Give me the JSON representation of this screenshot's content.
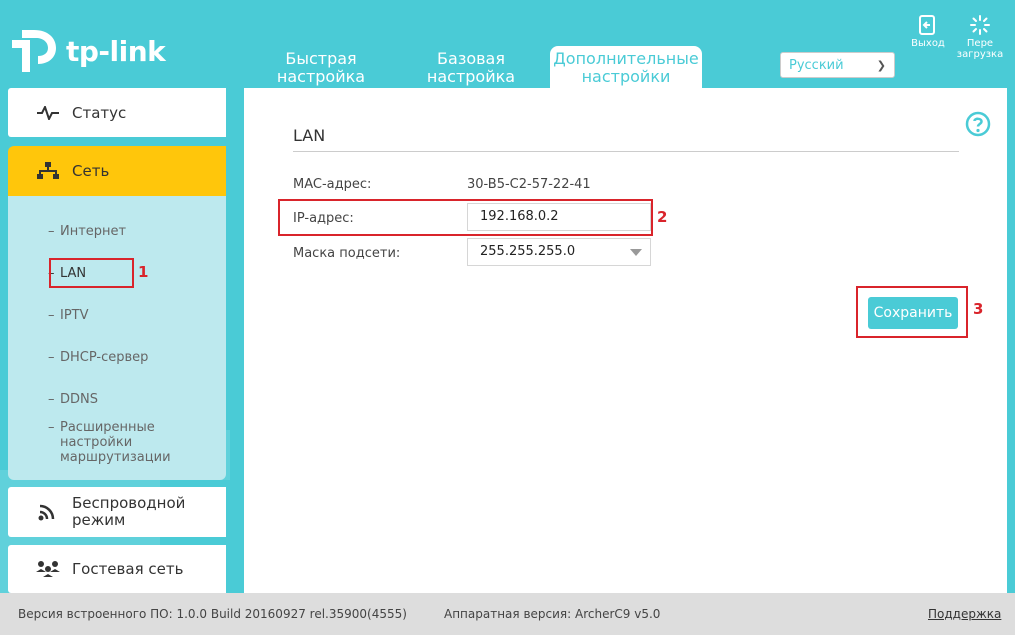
{
  "brand": {
    "logo_text": "tp-link"
  },
  "tabs": [
    {
      "label": "Быстрая\nнастройка"
    },
    {
      "label": "Базовая\nнастройка"
    },
    {
      "label": "Дополнительные\nнастройки"
    }
  ],
  "language": {
    "selected": "Русский"
  },
  "header_buttons": {
    "logout": "Выход",
    "reboot_line1": "Пере",
    "reboot_line2": "загрузка"
  },
  "sidebar": {
    "items": [
      {
        "label": "Статус",
        "icon": "pulse-icon"
      },
      {
        "label": "Сеть",
        "icon": "network-icon"
      },
      {
        "label": "Беспроводной режим",
        "icon": "wifi-icon"
      },
      {
        "label": "Гостевая сеть",
        "icon": "guest-icon"
      }
    ],
    "submenu": [
      {
        "label": "Интернет"
      },
      {
        "label": "LAN"
      },
      {
        "label": "IPTV"
      },
      {
        "label": "DHCP-сервер"
      },
      {
        "label": "DDNS"
      },
      {
        "label": "Расширенные настройки маршрутизации"
      }
    ],
    "wireless_line1": "Беспроводной",
    "wireless_line2": "режим"
  },
  "lan": {
    "title": "LAN",
    "mac_label": "MAC-адрес:",
    "mac_value": "30-B5-C2-57-22-41",
    "ip_label": "IP-адрес:",
    "ip_value": "192.168.0.2",
    "mask_label": "Маска подсети:",
    "mask_value": "255.255.255.0",
    "save_label": "Сохранить"
  },
  "annotations": {
    "n1": "1",
    "n2": "2",
    "n3": "3"
  },
  "footer": {
    "firmware": "Версия встроенного ПО: 1.0.0 Build 20160927 rel.35900(4555)",
    "hardware": "Аппаратная версия: ArcherC9 v5.0",
    "support": "Поддержка"
  },
  "colors": {
    "accent": "#4acbd6",
    "active_menu": "#ffc60b",
    "annotation": "#d9242b"
  }
}
